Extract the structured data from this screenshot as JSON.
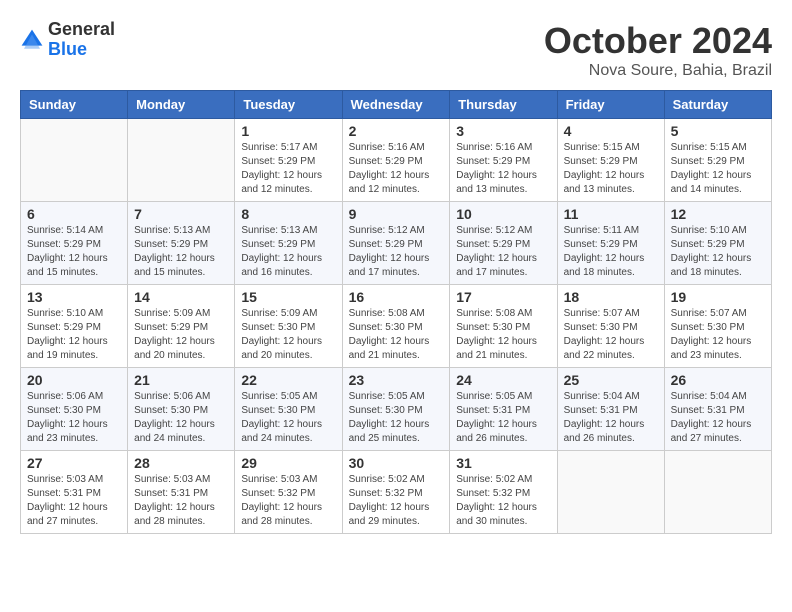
{
  "logo": {
    "general": "General",
    "blue": "Blue"
  },
  "title": "October 2024",
  "location": "Nova Soure, Bahia, Brazil",
  "weekdays": [
    "Sunday",
    "Monday",
    "Tuesday",
    "Wednesday",
    "Thursday",
    "Friday",
    "Saturday"
  ],
  "weeks": [
    [
      {
        "day": "",
        "sunrise": "",
        "sunset": "",
        "daylight": ""
      },
      {
        "day": "",
        "sunrise": "",
        "sunset": "",
        "daylight": ""
      },
      {
        "day": "1",
        "sunrise": "Sunrise: 5:17 AM",
        "sunset": "Sunset: 5:29 PM",
        "daylight": "Daylight: 12 hours and 12 minutes."
      },
      {
        "day": "2",
        "sunrise": "Sunrise: 5:16 AM",
        "sunset": "Sunset: 5:29 PM",
        "daylight": "Daylight: 12 hours and 12 minutes."
      },
      {
        "day": "3",
        "sunrise": "Sunrise: 5:16 AM",
        "sunset": "Sunset: 5:29 PM",
        "daylight": "Daylight: 12 hours and 13 minutes."
      },
      {
        "day": "4",
        "sunrise": "Sunrise: 5:15 AM",
        "sunset": "Sunset: 5:29 PM",
        "daylight": "Daylight: 12 hours and 13 minutes."
      },
      {
        "day": "5",
        "sunrise": "Sunrise: 5:15 AM",
        "sunset": "Sunset: 5:29 PM",
        "daylight": "Daylight: 12 hours and 14 minutes."
      }
    ],
    [
      {
        "day": "6",
        "sunrise": "Sunrise: 5:14 AM",
        "sunset": "Sunset: 5:29 PM",
        "daylight": "Daylight: 12 hours and 15 minutes."
      },
      {
        "day": "7",
        "sunrise": "Sunrise: 5:13 AM",
        "sunset": "Sunset: 5:29 PM",
        "daylight": "Daylight: 12 hours and 15 minutes."
      },
      {
        "day": "8",
        "sunrise": "Sunrise: 5:13 AM",
        "sunset": "Sunset: 5:29 PM",
        "daylight": "Daylight: 12 hours and 16 minutes."
      },
      {
        "day": "9",
        "sunrise": "Sunrise: 5:12 AM",
        "sunset": "Sunset: 5:29 PM",
        "daylight": "Daylight: 12 hours and 17 minutes."
      },
      {
        "day": "10",
        "sunrise": "Sunrise: 5:12 AM",
        "sunset": "Sunset: 5:29 PM",
        "daylight": "Daylight: 12 hours and 17 minutes."
      },
      {
        "day": "11",
        "sunrise": "Sunrise: 5:11 AM",
        "sunset": "Sunset: 5:29 PM",
        "daylight": "Daylight: 12 hours and 18 minutes."
      },
      {
        "day": "12",
        "sunrise": "Sunrise: 5:10 AM",
        "sunset": "Sunset: 5:29 PM",
        "daylight": "Daylight: 12 hours and 18 minutes."
      }
    ],
    [
      {
        "day": "13",
        "sunrise": "Sunrise: 5:10 AM",
        "sunset": "Sunset: 5:29 PM",
        "daylight": "Daylight: 12 hours and 19 minutes."
      },
      {
        "day": "14",
        "sunrise": "Sunrise: 5:09 AM",
        "sunset": "Sunset: 5:29 PM",
        "daylight": "Daylight: 12 hours and 20 minutes."
      },
      {
        "day": "15",
        "sunrise": "Sunrise: 5:09 AM",
        "sunset": "Sunset: 5:30 PM",
        "daylight": "Daylight: 12 hours and 20 minutes."
      },
      {
        "day": "16",
        "sunrise": "Sunrise: 5:08 AM",
        "sunset": "Sunset: 5:30 PM",
        "daylight": "Daylight: 12 hours and 21 minutes."
      },
      {
        "day": "17",
        "sunrise": "Sunrise: 5:08 AM",
        "sunset": "Sunset: 5:30 PM",
        "daylight": "Daylight: 12 hours and 21 minutes."
      },
      {
        "day": "18",
        "sunrise": "Sunrise: 5:07 AM",
        "sunset": "Sunset: 5:30 PM",
        "daylight": "Daylight: 12 hours and 22 minutes."
      },
      {
        "day": "19",
        "sunrise": "Sunrise: 5:07 AM",
        "sunset": "Sunset: 5:30 PM",
        "daylight": "Daylight: 12 hours and 23 minutes."
      }
    ],
    [
      {
        "day": "20",
        "sunrise": "Sunrise: 5:06 AM",
        "sunset": "Sunset: 5:30 PM",
        "daylight": "Daylight: 12 hours and 23 minutes."
      },
      {
        "day": "21",
        "sunrise": "Sunrise: 5:06 AM",
        "sunset": "Sunset: 5:30 PM",
        "daylight": "Daylight: 12 hours and 24 minutes."
      },
      {
        "day": "22",
        "sunrise": "Sunrise: 5:05 AM",
        "sunset": "Sunset: 5:30 PM",
        "daylight": "Daylight: 12 hours and 24 minutes."
      },
      {
        "day": "23",
        "sunrise": "Sunrise: 5:05 AM",
        "sunset": "Sunset: 5:30 PM",
        "daylight": "Daylight: 12 hours and 25 minutes."
      },
      {
        "day": "24",
        "sunrise": "Sunrise: 5:05 AM",
        "sunset": "Sunset: 5:31 PM",
        "daylight": "Daylight: 12 hours and 26 minutes."
      },
      {
        "day": "25",
        "sunrise": "Sunrise: 5:04 AM",
        "sunset": "Sunset: 5:31 PM",
        "daylight": "Daylight: 12 hours and 26 minutes."
      },
      {
        "day": "26",
        "sunrise": "Sunrise: 5:04 AM",
        "sunset": "Sunset: 5:31 PM",
        "daylight": "Daylight: 12 hours and 27 minutes."
      }
    ],
    [
      {
        "day": "27",
        "sunrise": "Sunrise: 5:03 AM",
        "sunset": "Sunset: 5:31 PM",
        "daylight": "Daylight: 12 hours and 27 minutes."
      },
      {
        "day": "28",
        "sunrise": "Sunrise: 5:03 AM",
        "sunset": "Sunset: 5:31 PM",
        "daylight": "Daylight: 12 hours and 28 minutes."
      },
      {
        "day": "29",
        "sunrise": "Sunrise: 5:03 AM",
        "sunset": "Sunset: 5:32 PM",
        "daylight": "Daylight: 12 hours and 28 minutes."
      },
      {
        "day": "30",
        "sunrise": "Sunrise: 5:02 AM",
        "sunset": "Sunset: 5:32 PM",
        "daylight": "Daylight: 12 hours and 29 minutes."
      },
      {
        "day": "31",
        "sunrise": "Sunrise: 5:02 AM",
        "sunset": "Sunset: 5:32 PM",
        "daylight": "Daylight: 12 hours and 30 minutes."
      },
      {
        "day": "",
        "sunrise": "",
        "sunset": "",
        "daylight": ""
      },
      {
        "day": "",
        "sunrise": "",
        "sunset": "",
        "daylight": ""
      }
    ]
  ]
}
